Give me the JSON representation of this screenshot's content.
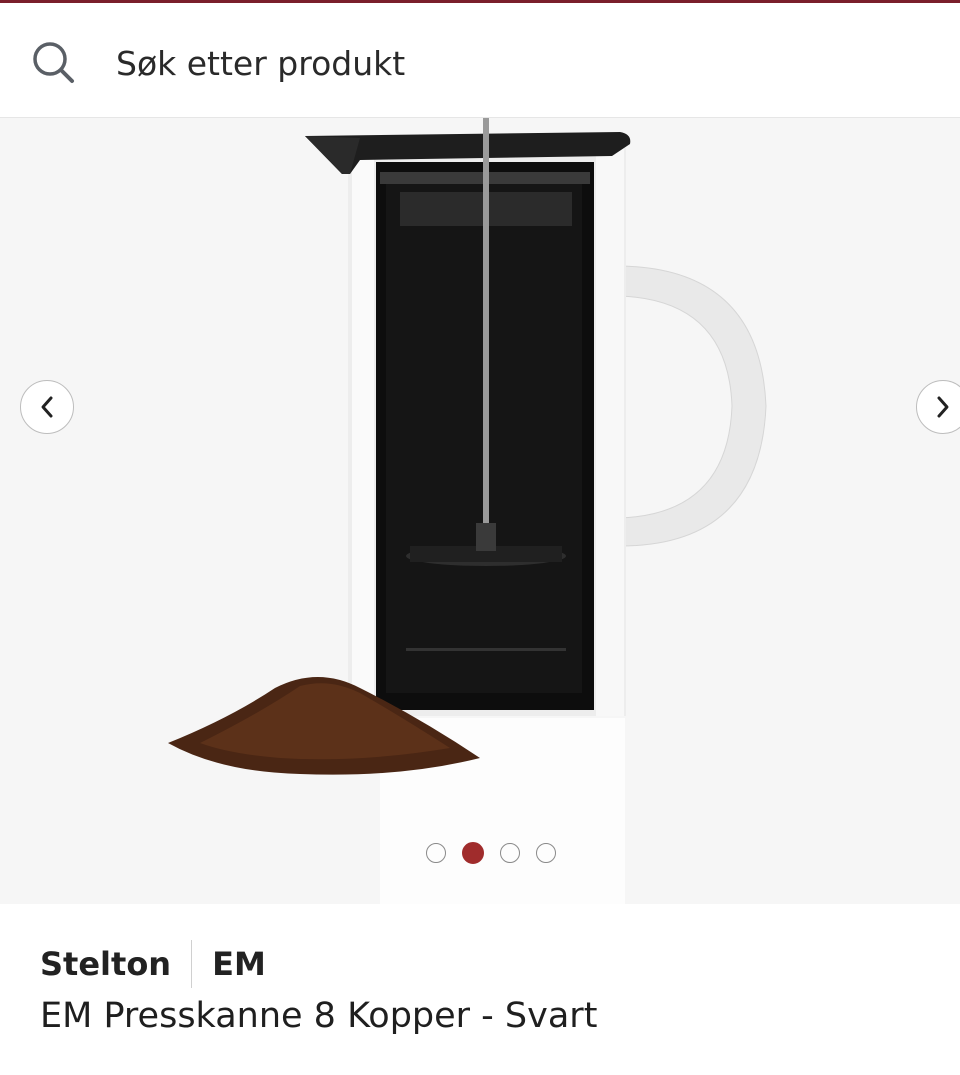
{
  "search": {
    "placeholder": "Søk etter produkt",
    "icon": "search-icon"
  },
  "gallery": {
    "image_alt": "EM Presskanne 8 Kopper - Svart",
    "total_images": 4,
    "active_index": 2,
    "prev_icon": "chevron-left-icon",
    "next_icon": "chevron-right-icon"
  },
  "product": {
    "brand": "Stelton",
    "series": "EM",
    "title": "EM Presskanne 8 Kopper - Svart"
  },
  "colors": {
    "accent": "#7a1f2b",
    "active_dot": "#a02c2c"
  }
}
